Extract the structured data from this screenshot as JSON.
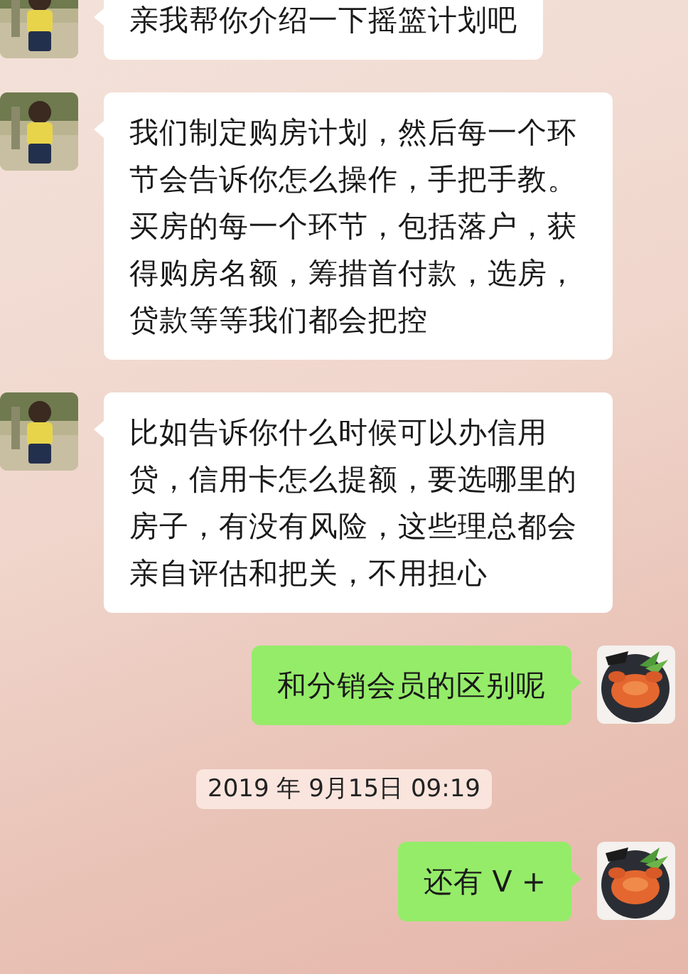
{
  "messages": [
    {
      "kind": "message",
      "outgoing": false,
      "text": "亲我帮你介绍一下摇篮计划吧"
    },
    {
      "kind": "message",
      "outgoing": false,
      "text": "我们制定购房计划，然后每一个环节会告诉你怎么操作，手把手教。买房的每一个环节，包括落户，获得购房名额，筹措首付款，选房，贷款等等我们都会把控"
    },
    {
      "kind": "message",
      "outgoing": false,
      "text": "比如告诉你什么时候可以办信用贷，信用卡怎么提额，要选哪里的房子，有没有风险，这些理总都会亲自评估和把关，不用担心"
    },
    {
      "kind": "message",
      "outgoing": true,
      "text": "和分销会员的区别呢"
    },
    {
      "kind": "timestamp",
      "text": "2019 年 9月15日 09:19"
    },
    {
      "kind": "message",
      "outgoing": true,
      "text": "还有 V +"
    }
  ]
}
